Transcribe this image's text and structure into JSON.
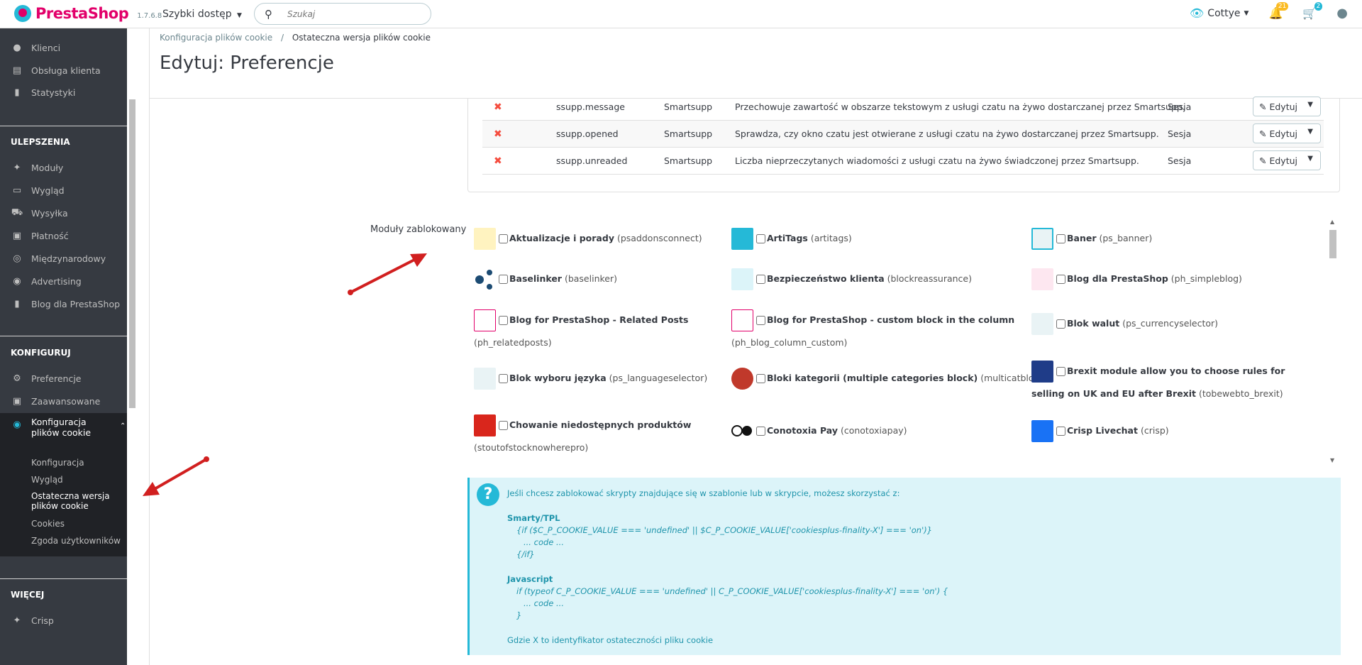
{
  "header": {
    "logo_text": "PrestaShop",
    "version": "1.7.6.8",
    "quick_access": "Szybki dostęp",
    "search_placeholder": "Szukaj",
    "user": "Cottye",
    "notifications_count": "21",
    "cart_count": "2"
  },
  "sidebar": {
    "items_top": [
      {
        "label": "Klienci",
        "icon": "user-icon"
      },
      {
        "label": "Obsługa klienta",
        "icon": "message-icon"
      },
      {
        "label": "Statystyki",
        "icon": "chart-icon"
      }
    ],
    "section_improve": "ULEPSZENIA",
    "items_improve": [
      {
        "label": "Moduły",
        "icon": "puzzle-icon"
      },
      {
        "label": "Wygląd",
        "icon": "monitor-icon"
      },
      {
        "label": "Wysyłka",
        "icon": "truck-icon"
      },
      {
        "label": "Płatność",
        "icon": "credit-card-icon"
      },
      {
        "label": "Międzynarodowy",
        "icon": "globe-icon"
      },
      {
        "label": "Advertising",
        "icon": "target-icon"
      },
      {
        "label": "Blog dla PrestaShop",
        "icon": "book-icon"
      }
    ],
    "section_configure": "KONFIGURUJ",
    "items_configure": [
      {
        "label": "Preferencje",
        "icon": "gear-icon"
      },
      {
        "label": "Zaawansowane",
        "icon": "settings-box-icon"
      }
    ],
    "active_item": "Konfiguracja plików cookie",
    "sub_items": [
      {
        "label": "Konfiguracja"
      },
      {
        "label": "Wygląd"
      },
      {
        "label": "Ostateczna wersja plików cookie"
      },
      {
        "label": "Cookies"
      },
      {
        "label": "Zgoda użytkowników"
      }
    ],
    "section_more": "WIĘCEJ",
    "items_more": [
      {
        "label": "Crisp",
        "icon": "puzzle-icon"
      }
    ]
  },
  "breadcrumb": {
    "parent": "Konfiguracja plików cookie",
    "separator": "/",
    "current": "Ostateczna wersja plików cookie"
  },
  "page_title": "Edytuj: Preferencje",
  "cookies_table": [
    {
      "name": "ssupp.message",
      "provider": "Smartsupp",
      "description": "Przechowuje zawartość w obszarze tekstowym z usługi czatu na żywo dostarczanej przez Smartsupp.",
      "expiry": "Sesja",
      "action": "Edytuj"
    },
    {
      "name": "ssupp.opened",
      "provider": "Smartsupp",
      "description": "Sprawdza, czy okno czatu jest otwierane z usługi czatu na żywo dostarczanej przez Smartsupp.",
      "expiry": "Sesja",
      "action": "Edytuj"
    },
    {
      "name": "ssupp.unreaded",
      "provider": "Smartsupp",
      "description": "Liczba nieprzeczytanych wiadomości z usługi czatu na żywo świadczonej przez Smartsupp.",
      "expiry": "Sesja",
      "action": "Edytuj"
    }
  ],
  "modules": {
    "label": "Moduły zablokowany",
    "items": [
      {
        "name": "Aktualizacje i porady",
        "tech": "(psaddonsconnect)"
      },
      {
        "name": "ArtiTags",
        "tech": "(artitags)"
      },
      {
        "name": "Baner",
        "tech": "(ps_banner)"
      },
      {
        "name": "Baselinker",
        "tech": "(baselinker)"
      },
      {
        "name": "Bezpieczeństwo klienta",
        "tech": "(blockreassurance)"
      },
      {
        "name": "Blog dla PrestaShop",
        "tech": "(ph_simpleblog)"
      },
      {
        "name": "Blog for PrestaShop - Related Posts",
        "tech": "(ph_relatedposts)"
      },
      {
        "name": "Blog for PrestaShop - custom block in the column",
        "tech": "(ph_blog_column_custom)"
      },
      {
        "name": "Blok walut",
        "tech": "(ps_currencyselector)"
      },
      {
        "name": "Blok wyboru języka",
        "tech": "(ps_languageselector)"
      },
      {
        "name": "Bloki kategorii (multiple categories block)",
        "tech": "(multicatblocks)"
      },
      {
        "name": "Brexit module allow you to choose rules for selling on UK and EU after Brexit",
        "tech": "(tobewebto_brexit)"
      },
      {
        "name": "Chowanie niedostępnych produktów",
        "tech": "(stoutofstocknowherepro)"
      },
      {
        "name": "Conotoxia Pay",
        "tech": "(conotoxiapay)"
      },
      {
        "name": "Crisp Livechat",
        "tech": "(crisp)"
      }
    ]
  },
  "info": {
    "intro": "Jeśli chcesz zablokować skrypty znajdujące się w szablonie lub w skrypcie, możesz skorzystać z:",
    "smarty_title": "Smarty/TPL",
    "smarty_line1": "{if ($C_P_COOKIE_VALUE === 'undefined' || $C_P_COOKIE_VALUE['cookiesplus-finality-X'] === 'on')}",
    "smarty_line2": "... code ...",
    "smarty_line3": "{/if}",
    "js_title": "Javascript",
    "js_line1": "if (typeof C_P_COOKIE_VALUE === 'undefined' || C_P_COOKIE_VALUE['cookiesplus-finality-X'] === 'on') {",
    "js_line2": "... code ...",
    "js_line3": "}",
    "footer": "Gdzie X to identyfikator ostateczności pliku cookie"
  },
  "colors": {
    "brand_pink": "#e2006a",
    "brand_blue": "#25b9d7",
    "sidebar_bg": "#363a41",
    "alert_bg": "#dcf4f9",
    "arrow": "#d11f1f"
  }
}
